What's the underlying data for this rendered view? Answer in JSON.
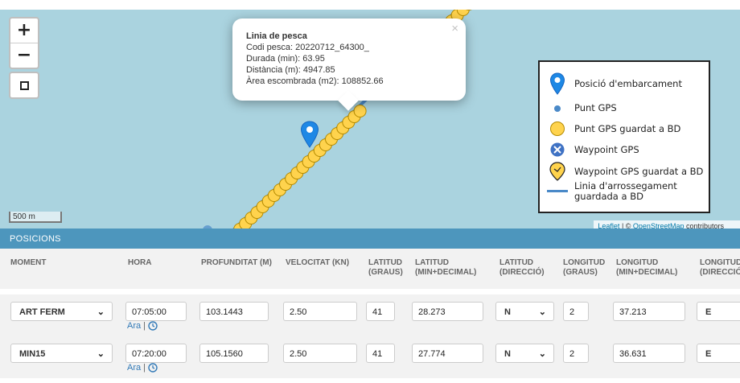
{
  "map": {
    "zoom_in_label": "+",
    "zoom_out_label": "−",
    "scale_label": "500 m",
    "attribution": {
      "leaflet": "Leaflet",
      "sep": " | © ",
      "osm": "OpenStreetMap",
      "suffix": " contributors"
    },
    "popup": {
      "title": "Linia de pesca",
      "lines": [
        "Codi pesca: 20220712_64300_",
        "Durada (min): 63.95",
        "Distància (m): 4947.85",
        "Àrea escombrada (m2): 108852.66"
      ],
      "close": "×"
    },
    "legend": [
      {
        "icon": "marker-icon",
        "label": "Posició d'embarcament"
      },
      {
        "icon": "gps-point-icon",
        "label": "Punt GPS"
      },
      {
        "icon": "saved-gps-point-icon",
        "label": "Punt GPS guardat a BD"
      },
      {
        "icon": "waypoint-icon",
        "label": "Waypoint GPS"
      },
      {
        "icon": "saved-waypoint-icon",
        "label": "Waypoint GPS guardat a BD"
      },
      {
        "icon": "drag-line-icon",
        "label": "Linia d'arrossegament guardada a BD"
      }
    ],
    "colors": {
      "sea": "#aad3df",
      "point": "#ffd34d",
      "line": "#4a89c8",
      "marker": "#1e88e5"
    }
  },
  "section_title": "POSICIONS",
  "columns": [
    [
      "MOMENT"
    ],
    [
      "HORA"
    ],
    [
      "PROFUNDITAT (M)"
    ],
    [
      "VELOCITAT (KN)"
    ],
    [
      "LATITUD",
      "(GRAUS)"
    ],
    [
      "LATITUD",
      "(MIN+DECIMAL)"
    ],
    [
      "LATITUD",
      "(DIRECCIÓ)"
    ],
    [
      "LONGITUD",
      "(GRAUS)"
    ],
    [
      "LONGITUD",
      "(MIN+DECIMAL)"
    ],
    [
      "LONGITUD",
      "(DIRECCIÓ)"
    ]
  ],
  "rows": [
    {
      "moment": "ART FERM",
      "hora": "07:05:00",
      "profunditat": "103.1443",
      "velocitat": "2.50",
      "lat_graus": "41",
      "lat_min": "28.273",
      "lat_dir": "N",
      "lon_graus": "2",
      "lon_min": "37.213",
      "lon_dir": "E"
    },
    {
      "moment": "MIN15",
      "hora": "07:20:00",
      "profunditat": "105.1560",
      "velocitat": "2.50",
      "lat_graus": "41",
      "lat_min": "27.774",
      "lat_dir": "N",
      "lon_graus": "2",
      "lon_min": "36.631",
      "lon_dir": "E"
    }
  ],
  "ara_label": "Ara",
  "ara_sep": "|"
}
